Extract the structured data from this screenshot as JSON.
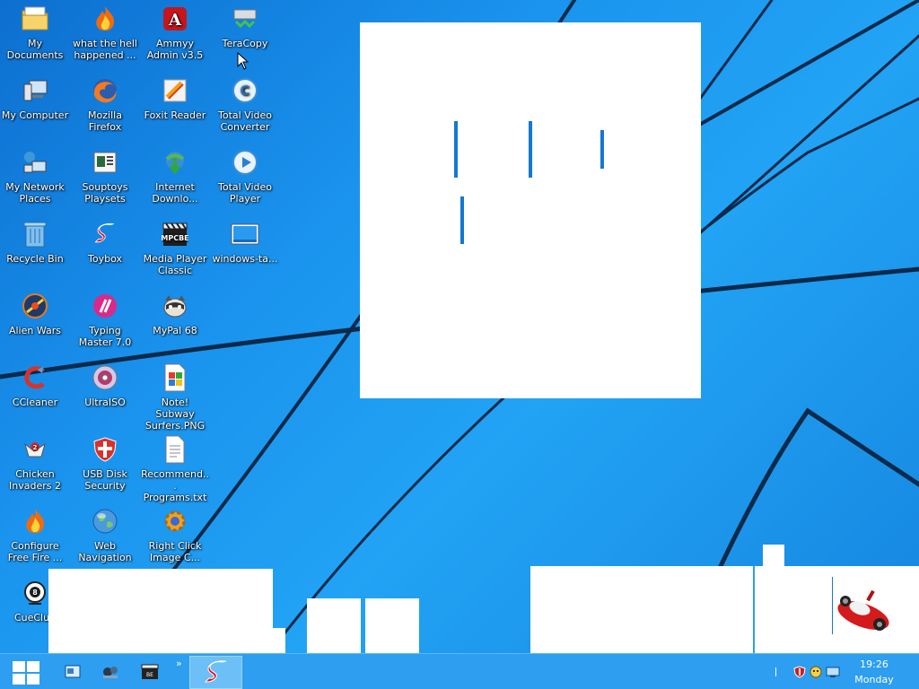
{
  "desktop": {
    "icons": [
      {
        "label": "My Documents",
        "icon": "folder-documents-icon"
      },
      {
        "label": "what the hell happened ...",
        "icon": "flame-icon"
      },
      {
        "label": "Ammyy Admin v3.5",
        "icon": "ammyy-admin-icon"
      },
      {
        "label": "TeraCopy",
        "icon": "teracopy-icon"
      },
      {
        "label": "My Computer",
        "icon": "computer-icon"
      },
      {
        "label": "Mozilla Firefox",
        "icon": "firefox-icon"
      },
      {
        "label": "Foxit Reader",
        "icon": "foxit-reader-icon"
      },
      {
        "label": "Total Video Converter",
        "icon": "video-converter-icon"
      },
      {
        "label": "My Network Places",
        "icon": "network-places-icon"
      },
      {
        "label": "Souptoys Playsets",
        "icon": "souptoys-icon"
      },
      {
        "label": "Internet Downlo...",
        "icon": "internet-download-manager-icon"
      },
      {
        "label": "Total Video Player",
        "icon": "video-player-icon"
      },
      {
        "label": "Recycle Bin",
        "icon": "recycle-bin-icon"
      },
      {
        "label": "Toybox",
        "icon": "toybox-icon"
      },
      {
        "label": "Media Player Classic",
        "icon": "media-player-classic-icon"
      },
      {
        "label": "windows-ta...",
        "icon": "image-file-icon"
      },
      {
        "label": "Alien Wars",
        "icon": "alien-wars-icon"
      },
      {
        "label": "Typing Master 7.0",
        "icon": "typing-master-icon"
      },
      {
        "label": "MyPal 68",
        "icon": "mypal-icon"
      },
      {
        "label": "CCleaner",
        "icon": "ccleaner-icon"
      },
      {
        "label": "UltraISO",
        "icon": "ultraiso-icon"
      },
      {
        "label": "Note! Subway Surfers.PNG",
        "icon": "png-file-icon"
      },
      {
        "label": "Chicken Invaders 2",
        "icon": "chicken-invaders-icon"
      },
      {
        "label": "USB Disk Security",
        "icon": "usb-disk-security-icon"
      },
      {
        "label": "Recommend... Programs.txt",
        "icon": "text-file-icon"
      },
      {
        "label": "Configure Free Fire ...",
        "icon": "flame-icon"
      },
      {
        "label": "Web Navigation",
        "icon": "web-globe-icon"
      },
      {
        "label": "Right Click Image C...",
        "icon": "gear-icon"
      },
      {
        "label": "CueClub",
        "icon": "cueclub-icon"
      }
    ]
  },
  "taskbar": {
    "pinned": [
      {
        "icon": "show-desktop-icon"
      },
      {
        "icon": "souptoys-icon"
      },
      {
        "icon": "media-player-classic-icon"
      }
    ],
    "overflow_label": "»",
    "active_app": {
      "icon": "toybox-icon"
    },
    "clock": {
      "time": "19:26",
      "day": "Monday"
    }
  },
  "colors": {
    "accent": "#1478d0",
    "taskbar": "#2d9ef0",
    "wallpaper": "#1a94ee"
  }
}
